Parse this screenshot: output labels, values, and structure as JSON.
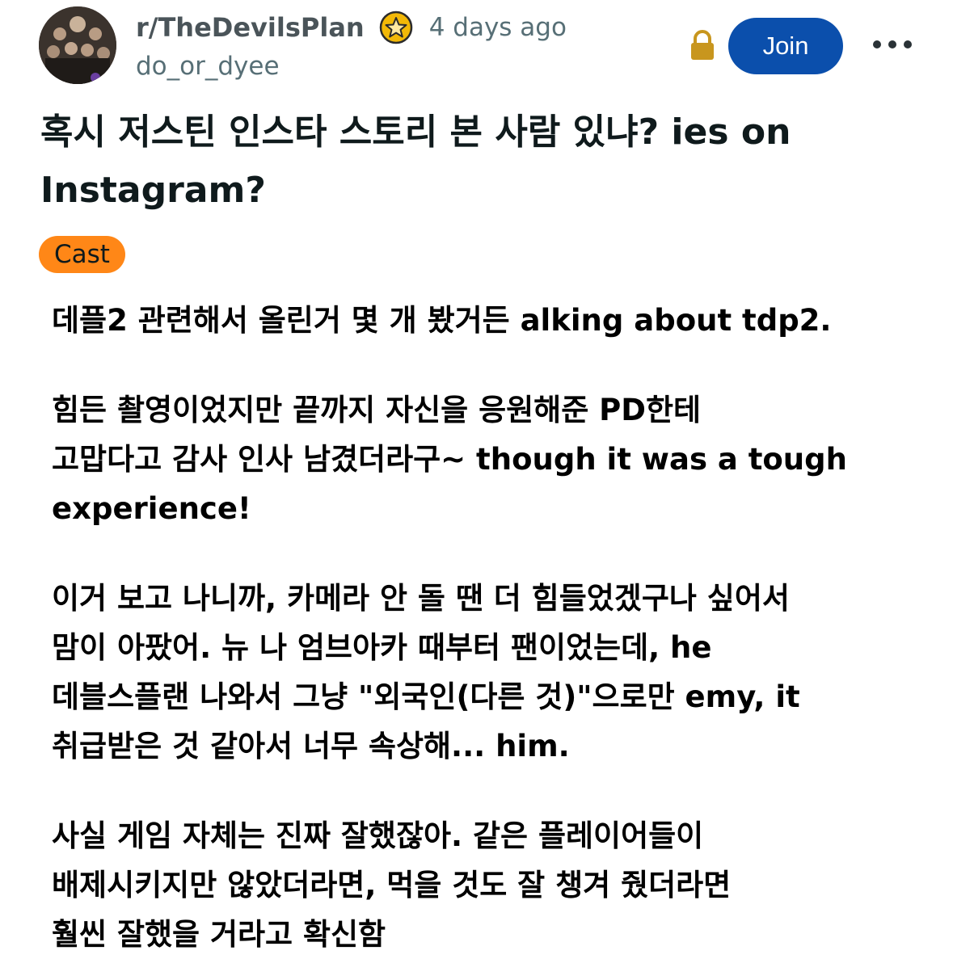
{
  "post": {
    "subreddit": "r/TheDevilsPlan",
    "time": "4 days ago",
    "author": "do_or_dyee",
    "join_label": "Join",
    "title": "혹시 저스틴 인스타 스토리 본 사람 있냐? ies on Instagram?",
    "flair": "Cast",
    "body": [
      "데플2 관련해서 올린거 몇 개 봤거든 alking about tdp2.",
      "힘든 촬영이었지만 끝까지 자신을 응원해준 PD한테\n고맙다고 감사 인사 남겼더라구~ though it was a tough\nexperience!",
      "이거 보고 나니까, 카메라 안 돌 땐 더 힘들었겠구나 싶어서\n맘이 아팠어. 뉴 나 엄브아카 때부터 팬이었는데, he\n데블스플랜 나와서 그냥 \"외국인(다른 것)\"으로만 emy, it\n취급받은 것 같아서 너무 속상해... him.",
      "사실 게임 자체는 진짜 잘했잖아. 같은 플레이어들이\n배제시키지만 않았더라면, 먹을 것도 잘 챙겨 줬더라면\n훨씬 잘했을 거라고 확신함"
    ]
  },
  "icons": {
    "avatar": "subreddit-avatar",
    "badge": "star-badge-icon",
    "lock": "lock-icon",
    "more": "more-options-icon"
  },
  "colors": {
    "join": "#0b4fac",
    "flair": "#ff8717",
    "lock": "#c8961e",
    "muted": "#576f76"
  }
}
